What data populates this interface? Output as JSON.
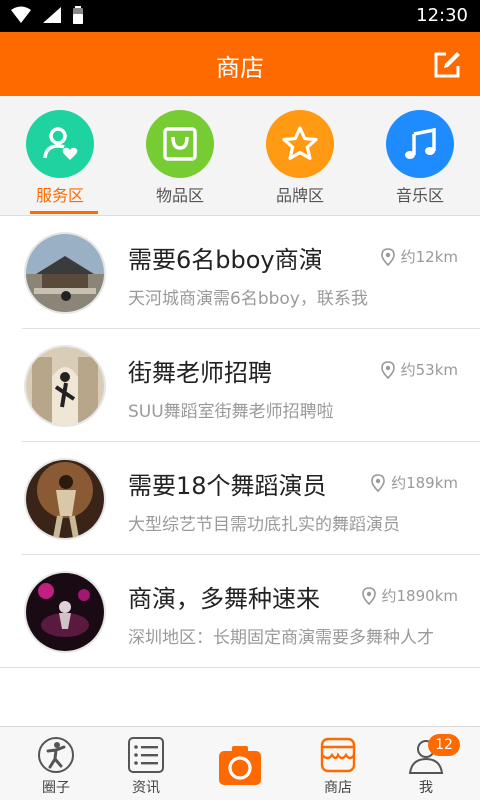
{
  "status_bar": {
    "time": "12:30"
  },
  "header": {
    "title": "商店",
    "edit_icon": "edit-square-icon"
  },
  "categories": [
    {
      "label": "服务区",
      "icon": "user-heart-icon",
      "color": "#1ed3a0",
      "active": true
    },
    {
      "label": "物品区",
      "icon": "shopping-bag-icon",
      "color": "#77cc33",
      "active": false
    },
    {
      "label": "品牌区",
      "icon": "star-icon",
      "color": "#ff9a12",
      "active": false
    },
    {
      "label": "音乐区",
      "icon": "music-note-icon",
      "color": "#1e8cff",
      "active": false
    }
  ],
  "items": [
    {
      "title": "需要6名bboy商演",
      "distance": "约12km",
      "desc": "天河城商演需6名bboy，联系我"
    },
    {
      "title": "街舞老师招聘",
      "distance": "约53km",
      "desc": "SUU舞蹈室街舞老师招聘啦"
    },
    {
      "title": "需要18个舞蹈演员",
      "distance": "约189km",
      "desc": "大型综艺节目需功底扎实的舞蹈演员"
    },
    {
      "title": "商演，多舞种速来",
      "distance": "约1890km",
      "desc": "深圳地区：长期固定商演需要多舞种人才"
    }
  ],
  "bottom_nav": [
    {
      "label": "圈子",
      "icon": "dancer-icon",
      "active": false
    },
    {
      "label": "资讯",
      "icon": "list-icon",
      "active": false
    },
    {
      "label": "",
      "icon": "camera-icon",
      "active": false
    },
    {
      "label": "商店",
      "icon": "store-icon",
      "active": true
    },
    {
      "label": "我",
      "icon": "person-icon",
      "active": false
    }
  ],
  "badge_count": "12",
  "accent_color": "#ff6a00"
}
